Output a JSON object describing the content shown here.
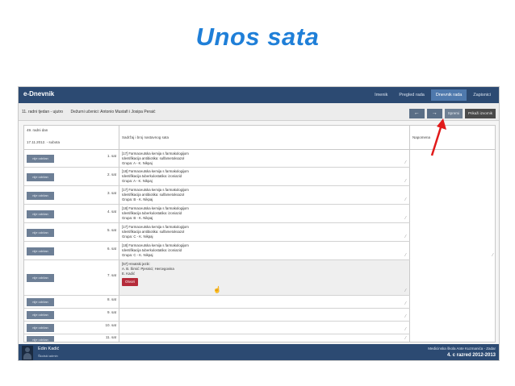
{
  "slide": {
    "title": "Unos sata"
  },
  "app": {
    "brand": "e-Dnevnik",
    "nav": [
      {
        "label": "Imenik",
        "active": false
      },
      {
        "label": "Pregled rada",
        "active": false
      },
      {
        "label": "Dnevnik rada",
        "active": true
      },
      {
        "label": "Zapisnici",
        "active": false
      }
    ],
    "subbar": {
      "week": "11. radni tjedan - ujutro",
      "duty": "Dežurni učenici: Antonio Mustafi i Josipa Peraić",
      "prev_symbol": "←",
      "next_symbol": "→",
      "save_label": "Spremi",
      "print_label": "Prikaži izvornik"
    },
    "table": {
      "day": "49. radni dan",
      "date": "17.11.2012. - subota",
      "col_content": "Sadržaj i broj nastavnog sata",
      "col_notes": "Napomena",
      "status_label": "nije održan",
      "open_label": "Otvori",
      "rows": [
        {
          "hour": "1. sat",
          "lines": [
            "[17] Farmaceutska kemija s farmakologijom",
            "Identifikacija antibiotika: sulfametoksazol",
            "Grupa: A - K. Nikpaj"
          ]
        },
        {
          "hour": "2. sat",
          "lines": [
            "[18] Farmaceutska kemija s farmakologijom",
            "Identifikacija tuberkulostatika: izoniazid",
            "Grupa: A - K. Nikpaj"
          ]
        },
        {
          "hour": "3. sat",
          "lines": [
            "[17] Farmaceutska kemija s farmakologijom",
            "Identifikacija antibiotika: sulfametoksazol",
            "Grupa: B - K. Nikpaj"
          ]
        },
        {
          "hour": "4. sat",
          "lines": [
            "[18] Farmaceutska kemija s farmakologijom",
            "Identifikacija tuberkulostatika: izoniazid",
            "Grupa: B - K. Nikpaj"
          ]
        },
        {
          "hour": "5. sat",
          "lines": [
            "[17] Farmaceutska kemija s farmakologijom",
            "Identifikacija antibiotika: sulfametoksazol",
            "Grupa: C - K. Nikpaj"
          ]
        },
        {
          "hour": "6. sat",
          "lines": [
            "[18] Farmaceutska kemija s farmakologijom",
            "Identifikacija tuberkulostatika: izoniazid",
            "Grupa: C - K. Nikpaj"
          ]
        },
        {
          "hour": "7. sat",
          "lines": [
            "[57] Hrvatski jezik:",
            "A. B. Šimić: Pjesnici; Hercegovina",
            "E. Kadić"
          ],
          "highlight": true
        },
        {
          "hour": "8. sat",
          "lines": []
        },
        {
          "hour": "9. sat",
          "lines": []
        },
        {
          "hour": "10. sat",
          "lines": []
        },
        {
          "hour": "11. sat",
          "lines": []
        }
      ]
    },
    "footer": {
      "user_name": "Edin Kadić",
      "user_role": "Školski admin",
      "school": "Medicinska škola Ante Kuzmanića - Zadar",
      "class": "4. c razred 2012-2013"
    }
  }
}
